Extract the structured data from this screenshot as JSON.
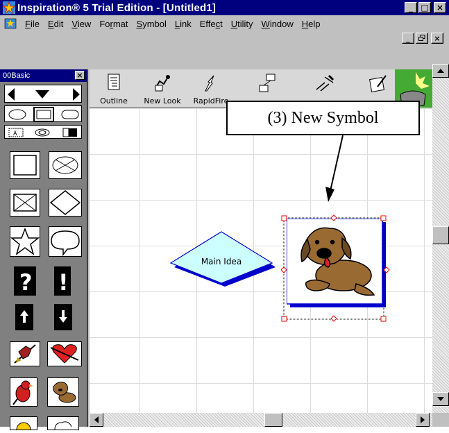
{
  "window": {
    "title": "Inspiration® 5 Trial Edition - [Untitled1]"
  },
  "title_buttons": {
    "minimize": "_",
    "restore": "□",
    "close": "×"
  },
  "menu": [
    {
      "pre": "",
      "u": "F",
      "post": "ile"
    },
    {
      "pre": "",
      "u": "E",
      "post": "dit"
    },
    {
      "pre": "",
      "u": "V",
      "post": "iew"
    },
    {
      "pre": "Fo",
      "u": "r",
      "post": "mat"
    },
    {
      "pre": "",
      "u": "S",
      "post": "ymbol"
    },
    {
      "pre": "",
      "u": "L",
      "post": "ink"
    },
    {
      "pre": "Effe",
      "u": "c",
      "post": "t"
    },
    {
      "pre": "",
      "u": "U",
      "post": "tility"
    },
    {
      "pre": "",
      "u": "W",
      "post": "indow"
    },
    {
      "pre": "",
      "u": "H",
      "post": "elp"
    }
  ],
  "palette": {
    "title": "00Basic",
    "close": "×"
  },
  "toolbar": [
    {
      "label": "Outline",
      "icon": "outline-icon"
    },
    {
      "label": "New Look",
      "icon": "new-look-icon"
    },
    {
      "label": "RapidFire",
      "icon": "rapidfire-icon"
    },
    {
      "label": "",
      "icon": "create-icon"
    },
    {
      "label": "",
      "icon": "link-icon"
    },
    {
      "label": "",
      "icon": "note-icon"
    }
  ],
  "diagram": {
    "main_idea": "Main Idea"
  },
  "callout": {
    "text": "(3) New Symbol"
  },
  "colors": {
    "titlebar": "#00007f",
    "diamond_fill": "#ccffff",
    "diamond_border": "#0000cc",
    "selection": "#ff0000"
  }
}
